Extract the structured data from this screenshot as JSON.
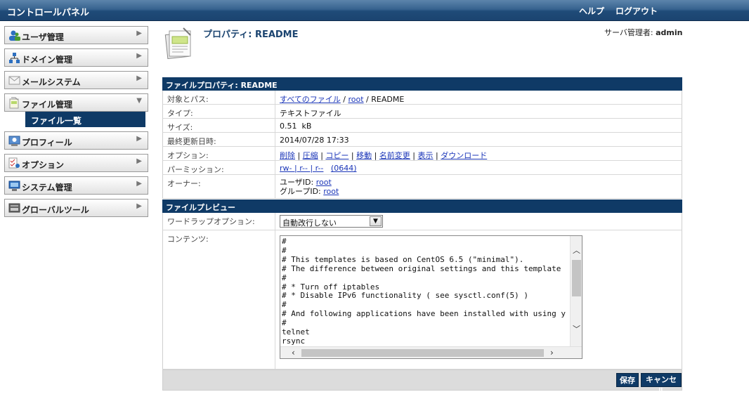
{
  "app": {
    "title": "コントロールパネル",
    "help": "ヘルプ",
    "logout": "ログアウト"
  },
  "sidebar": {
    "items": [
      {
        "label": "ユーザ管理",
        "icon": "users-icon"
      },
      {
        "label": "ドメイン管理",
        "icon": "domain-icon"
      },
      {
        "label": "メールシステム",
        "icon": "mail-icon"
      },
      {
        "label": "ファイル管理",
        "icon": "file-manager-icon"
      },
      {
        "label": "プロフィール",
        "icon": "profile-icon"
      },
      {
        "label": "オプション",
        "icon": "options-icon"
      },
      {
        "label": "システム管理",
        "icon": "system-icon"
      },
      {
        "label": "グローバルツール",
        "icon": "global-tools-icon"
      }
    ],
    "sub_item": "ファイル一覧"
  },
  "header": {
    "title": "プロパティ: README",
    "user_label": "サーバ管理者: ",
    "user_name": "admin"
  },
  "properties": {
    "heading": "ファイルプロパティ: README",
    "path_label": "対象とパス:",
    "path_all_files": "すべてのファイル",
    "path_sep1": " / ",
    "path_root": "root",
    "path_sep2": " / README",
    "type_label": "タイプ:",
    "type_value": "テキストファイル",
    "size_label": "サイズ:",
    "size_value": "0.51  kB",
    "modified_label": "最終更新日時:",
    "modified_value": "2014/07/28 17:33",
    "options_label": "オプション:",
    "options": [
      "削除",
      "圧縮",
      "コピー",
      "移動",
      "名前変更",
      "表示",
      "ダウンロード"
    ],
    "permission_label": "パーミッション:",
    "permission_value": "rw- | r-- | r--",
    "permission_octal": "(0644)",
    "owner_label": "オーナー:",
    "owner_user_label": "ユーザID: ",
    "owner_user": "root",
    "owner_group_label": "グループID: ",
    "owner_group": "root"
  },
  "preview": {
    "heading": "ファイルプレビュー",
    "wrap_label": "ワードラップオプション:",
    "wrap_value": "自動改行しない",
    "content_label": "コンテンツ:",
    "content_text": "#\n#\n# This templates is based on CentOS 6.5 (\"minimal\").\n# The difference between original settings and this template\n#\n# * Turn off iptables\n# * Disable IPv6 functionality ( see sysctl.conf(5) )\n#\n# And following applications have been installed with using y\n#\ntelnet\nrsync"
  },
  "buttons": {
    "save": "保存",
    "cancel": "キャンセル"
  }
}
